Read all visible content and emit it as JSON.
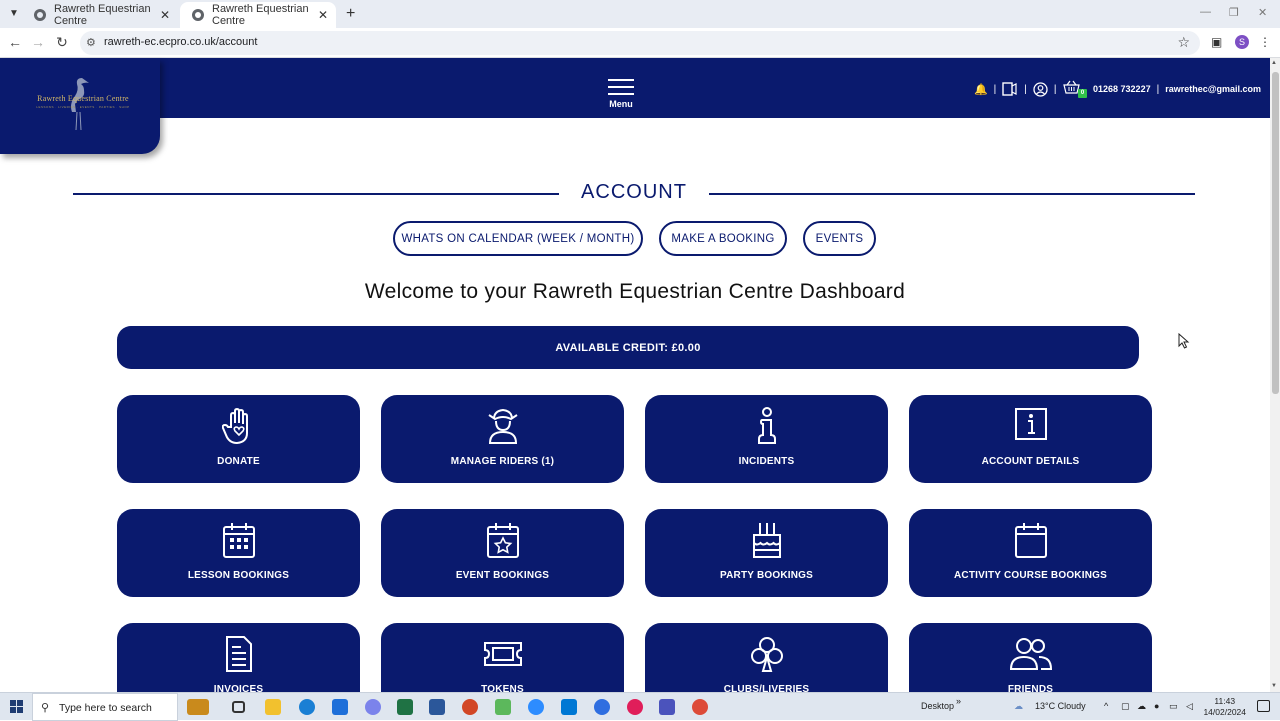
{
  "browser": {
    "tabs": [
      {
        "title": "Rawreth Equestrian Centre",
        "active": false
      },
      {
        "title": "Rawreth Equestrian Centre",
        "active": true
      }
    ],
    "url": "rawreth-ec.ecpro.co.uk/account",
    "profile_initial": "S"
  },
  "header": {
    "logo_text": "Rawreth Equestrian Centre",
    "logo_subtext": "LESSONS · LIVERIES · EVENTS · PARTIES · SHOP",
    "menu_label": "Menu",
    "cart_count": "0",
    "phone": "01268 732227",
    "email": "rawrethec@gmail.com",
    "colors": {
      "brand": "#0a1a6e",
      "notify": "#30c24a"
    }
  },
  "page": {
    "title": "ACCOUNT",
    "pills": [
      "WHATS ON CALENDAR (WEEK / MONTH)",
      "MAKE A BOOKING",
      "EVENTS"
    ],
    "welcome": "Welcome to your Rawreth Equestrian Centre Dashboard",
    "credit": "AVAILABLE CREDIT: £0.00",
    "tiles": [
      {
        "label": "DONATE",
        "icon": "hand-heart-icon"
      },
      {
        "label": "MANAGE RIDERS (1)",
        "icon": "rider-icon"
      },
      {
        "label": "INCIDENTS",
        "icon": "info-figure-icon"
      },
      {
        "label": "ACCOUNT DETAILS",
        "icon": "info-box-icon"
      },
      {
        "label": "LESSON BOOKINGS",
        "icon": "calendar-grid-icon"
      },
      {
        "label": "EVENT BOOKINGS",
        "icon": "calendar-star-icon"
      },
      {
        "label": "PARTY BOOKINGS",
        "icon": "birthday-cake-icon"
      },
      {
        "label": "ACTIVITY COURSE BOOKINGS",
        "icon": "calendar-blank-icon"
      },
      {
        "label": "INVOICES",
        "icon": "invoice-icon"
      },
      {
        "label": "TOKENS",
        "icon": "ticket-icon"
      },
      {
        "label": "CLUBS/LIVERIES",
        "icon": "club-icon"
      },
      {
        "label": "FRIENDS",
        "icon": "people-icon"
      }
    ]
  },
  "taskbar": {
    "search_placeholder": "Type here to search",
    "desktop_label": "Desktop",
    "weather": "13°C  Cloudy",
    "time": "11:43",
    "date": "14/02/2024"
  }
}
